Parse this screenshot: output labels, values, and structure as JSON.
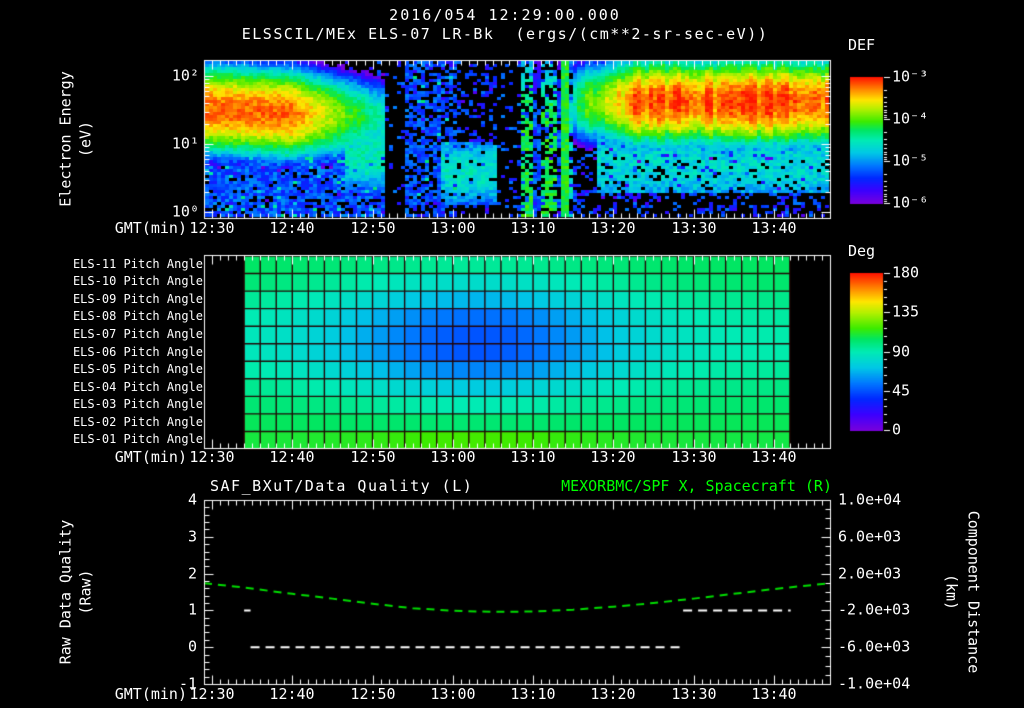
{
  "page": {
    "background": "#000000"
  },
  "header": {
    "title_datetime": "2016/054 12:29:00.000",
    "title_source": "ELSSCIL/MEx ELS-07 LR-Bk  (ergs/(cm**2-sr-sec-eV))"
  },
  "time_axis": {
    "label": "GMT(min)",
    "start": "12:29",
    "end": "13:47",
    "total_minutes": 78,
    "tick_labels": [
      "12:30",
      "12:40",
      "12:50",
      "13:00",
      "13:10",
      "13:20",
      "13:30",
      "13:40"
    ],
    "tick_minutes": [
      1,
      11,
      21,
      31,
      41,
      51,
      61,
      71
    ]
  },
  "top_panel": {
    "ylabel": "Electron Energy",
    "ylabel_units": "(eV)",
    "ytick_labels": [
      "10²",
      "10¹",
      "10⁰"
    ],
    "colorbar": {
      "title": "DEF",
      "tick_labels": [
        "10⁻³",
        "10⁻⁴",
        "10⁻⁵",
        "10⁻⁶"
      ]
    }
  },
  "middle_panel": {
    "row_labels": [
      "ELS-11 Pitch Angle",
      "ELS-10 Pitch Angle",
      "ELS-09 Pitch Angle",
      "ELS-08 Pitch Angle",
      "ELS-07 Pitch Angle",
      "ELS-06 Pitch Angle",
      "ELS-05 Pitch Angle",
      "ELS-04 Pitch Angle",
      "ELS-03 Pitch Angle",
      "ELS-02 Pitch Angle",
      "ELS-01 Pitch Angle"
    ],
    "colorbar": {
      "title": "Deg",
      "tick_labels": [
        "180",
        "135",
        "90",
        "45",
        "0"
      ]
    }
  },
  "bottom_panel": {
    "title_left": "SAF_BXuT/Data Quality (L)",
    "title_right": "MEXORBMC/SPF X, Spacecraft (R)",
    "ylabel_left": "Raw Data Quality",
    "ylabel_left_units": "(Raw)",
    "ylabel_right": "Component Distance",
    "ylabel_right_units": "(km)",
    "left_ticks": [
      "4",
      "3",
      "2",
      "1",
      "0",
      "-1"
    ],
    "right_ticks": [
      "1.0e+04",
      "6.0e+03",
      "2.0e+03",
      "-2.0e+03",
      "-6.0e+03",
      "-1.0e+04"
    ]
  },
  "colors": {
    "foreground": "#ffffff",
    "right_title_green": "#00ff00",
    "quality_line": "#ffffff",
    "spacecraft_line": "#00dd00",
    "background": "#000000"
  },
  "chart_data": [
    {
      "type": "heatmap",
      "name": "electron-energy-spectrogram",
      "title": "ELSSCIL/MEx ELS-07 LR-Bk",
      "units": "ergs/(cm**2-sr-sec-eV)",
      "x_start": "12:29",
      "x_end": "13:47",
      "y_scale": "log",
      "y_range_ev": [
        1,
        178
      ],
      "color_scale": {
        "label": "DEF",
        "min": 1e-06,
        "max": 0.001
      },
      "features": [
        {
          "name": "warm-band-left",
          "t": [
            0,
            23.5
          ],
          "fade_start": 11,
          "center_logE": 1.52,
          "falloff": 1.3,
          "peak_u": 0.93,
          "end_u": 0.45,
          "peak_logF": -3.2
        },
        {
          "name": "low-energy-noise-left",
          "t": [
            0,
            24
          ],
          "logE_max": 0.85,
          "density": 0.8,
          "u": [
            0.16,
            0.34
          ],
          "logF": [
            -5.5,
            -5.0
          ]
        },
        {
          "name": "cyan-blob-1",
          "t": [
            17.5,
            22.5
          ],
          "logE": [
            0.3,
            1.4
          ],
          "center_logE": 0.85,
          "peak_u": 0.5,
          "falloff": 1.0,
          "peak_logF": -4.5
        },
        {
          "name": "data-gap-1",
          "t": [
            22.5,
            25
          ],
          "density": 0.1
        },
        {
          "name": "blue-columns",
          "t": [
            25,
            31.5
          ],
          "density": 0.55,
          "u": [
            0.18,
            0.33
          ],
          "logF": [
            -5.5,
            -5.0
          ]
        },
        {
          "name": "cyan-blob-2",
          "t": [
            29.5,
            36.5
          ],
          "logE": [
            0.1,
            1.05
          ],
          "center_logE": 0.6,
          "peak_u": 0.47,
          "falloff": 0.9,
          "peak_logF": -4.6
        },
        {
          "name": "data-gap-2",
          "t": [
            36.5,
            39.5
          ],
          "density": 0.18
        },
        {
          "name": "streak-region",
          "t": [
            39.5,
            46
          ],
          "density": 0.6,
          "bright_line_t": 45
        },
        {
          "name": "warm-band-right",
          "t": [
            46,
            78
          ],
          "ramp_minutes": 8,
          "center_logE": 1.62,
          "falloff": 1.35,
          "start_u": 0.55,
          "peak_u": 0.95,
          "peak_logF": -3.1
        },
        {
          "name": "cyan-band-right",
          "t": [
            49,
            78
          ],
          "logE": [
            0.3,
            1.1
          ],
          "center_logE": 0.7,
          "peak_u": 0.44,
          "falloff": 0.55
        },
        {
          "name": "global-speckle",
          "density": 0.28,
          "u": [
            0.12,
            0.3
          ],
          "logF": [
            -5.8,
            -5.3
          ]
        }
      ]
    },
    {
      "type": "heatmap",
      "name": "pitch-angle-panels",
      "rows_top_to_bottom": [
        "ELS-11",
        "ELS-10",
        "ELS-09",
        "ELS-08",
        "ELS-07",
        "ELS-06",
        "ELS-05",
        "ELS-04",
        "ELS-03",
        "ELS-02",
        "ELS-01"
      ],
      "x_start_min": 5,
      "x_end_min": 73,
      "cell_minutes": 2,
      "columns": 34,
      "units": "deg",
      "color_range": [
        0,
        180
      ],
      "row_edge_deg": [
        105,
        103,
        98,
        94,
        92,
        92,
        95,
        99,
        103,
        106,
        108
      ],
      "row_center_deg": [
        95,
        82,
        68,
        52,
        46,
        46,
        57,
        74,
        90,
        102,
        118
      ],
      "dip_center_min": 34,
      "dip_sigma_min": 13
    },
    {
      "type": "line",
      "name": "quality-and-spacecraft-distance",
      "x_axis": "GMT minutes from 12:29",
      "left_axis": {
        "label": "Raw Data Quality (Raw)",
        "range": [
          -1,
          4
        ]
      },
      "right_axis": {
        "label": "Component Distance (km)",
        "range": [
          -10000,
          10000
        ]
      },
      "series": [
        {
          "name": "SAF_BXuT/Data Quality",
          "axis": "left",
          "color": "#ffffff",
          "style": "dashed",
          "segments": [
            {
              "t_min": [
                5.0,
                5.8
              ],
              "value": 1
            },
            {
              "t_min": [
                5.8,
                59.7
              ],
              "value": 0
            },
            {
              "t_min": [
                59.7,
                73.1
              ],
              "value": 1
            }
          ]
        },
        {
          "name": "MEXORBMC/SPF X Spacecraft",
          "axis": "right",
          "color": "#00dd00",
          "style": "dashed",
          "t_min": [
            0,
            5,
            11,
            16,
            21,
            26,
            31,
            36,
            41,
            46,
            51,
            56,
            61,
            66,
            71,
            78
          ],
          "km": [
            960,
            480,
            -200,
            -720,
            -1280,
            -1760,
            -2040,
            -2160,
            -2120,
            -1920,
            -1600,
            -1200,
            -720,
            -200,
            320,
            960
          ]
        }
      ]
    }
  ]
}
